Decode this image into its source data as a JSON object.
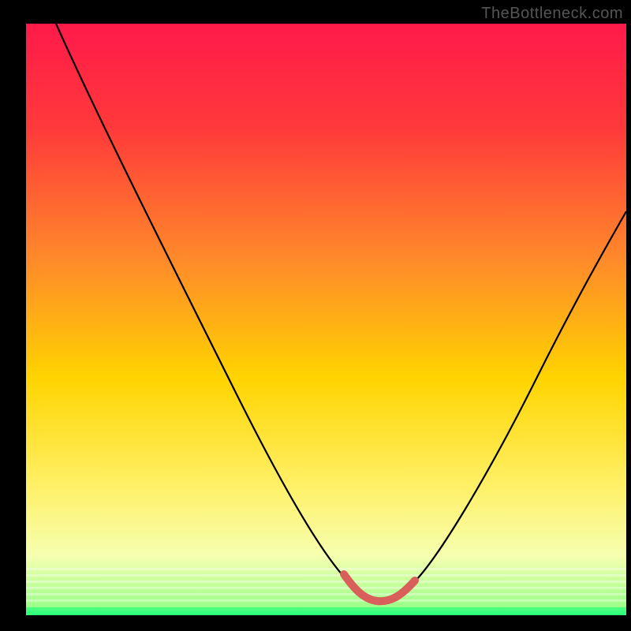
{
  "watermark": "TheBottleneck.com",
  "colors": {
    "frame": "#000000",
    "gradient_top": "#ff1a4a",
    "gradient_mid_upper": "#ff7a2a",
    "gradient_mid": "#ffe600",
    "gradient_lower": "#f6ffb0",
    "gradient_bottom": "#2aff7a",
    "curve": "#000000",
    "highlight": "#d9605a"
  },
  "chart_data": {
    "type": "line",
    "title": "",
    "xlabel": "",
    "ylabel": "",
    "xlim": [
      0,
      100
    ],
    "ylim": [
      0,
      100
    ],
    "series": [
      {
        "name": "bottleneck-curve",
        "x": [
          5,
          10,
          15,
          20,
          25,
          30,
          35,
          40,
          45,
          50,
          53,
          55,
          57,
          59,
          60,
          62,
          65,
          70,
          75,
          80,
          85,
          90,
          95,
          100
        ],
        "y": [
          100,
          90,
          80,
          70,
          60,
          50,
          41,
          32,
          24,
          15,
          9,
          6,
          4,
          3,
          3,
          4,
          6,
          12,
          20,
          29,
          38,
          47,
          56,
          65
        ]
      },
      {
        "name": "optimal-zone-highlight",
        "x": [
          53,
          55,
          57,
          59,
          60,
          62,
          65
        ],
        "y": [
          9,
          6,
          4,
          3,
          3,
          4,
          6
        ]
      }
    ],
    "annotations": []
  }
}
